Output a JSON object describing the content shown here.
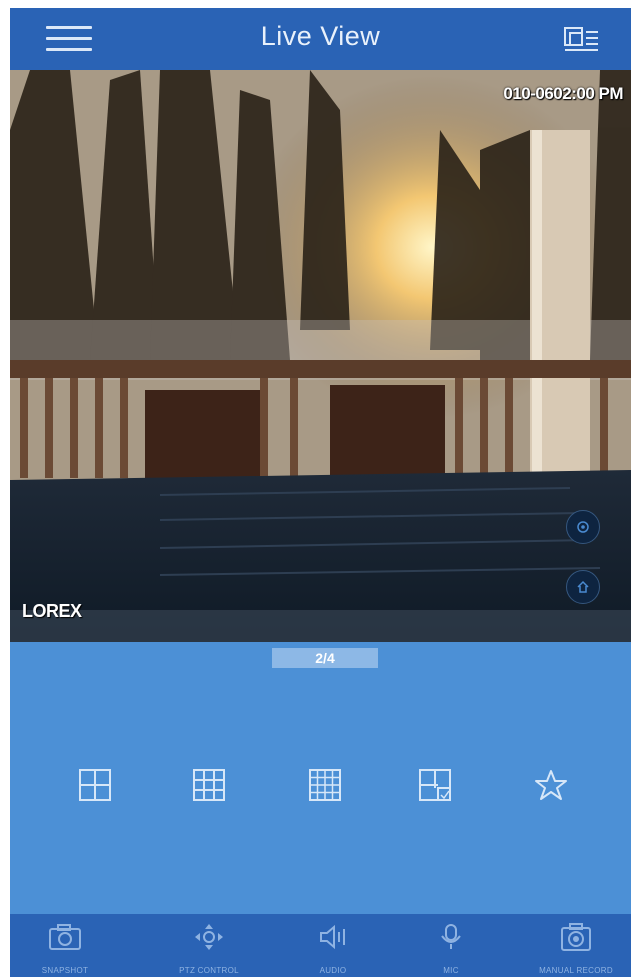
{
  "header": {
    "title": "Live View"
  },
  "video": {
    "timestamp": "010-0602:00 PM",
    "brand": "LOREX"
  },
  "pager": {
    "label": "2/4"
  },
  "layouts": [
    "single-view",
    "quad-view",
    "nine-view",
    "sixteen-view",
    "custom-view",
    "favorites"
  ],
  "toolbar": {
    "items": [
      {
        "label": "SNAPSHOT",
        "icon": "camera-icon"
      },
      {
        "label": "PTZ CONTROL",
        "icon": "ptz-icon"
      },
      {
        "label": "AUDIO",
        "icon": "speaker-icon"
      },
      {
        "label": "MIC",
        "icon": "mic-icon"
      },
      {
        "label": "MANUAL RECORD",
        "icon": "record-icon"
      }
    ]
  },
  "colors": {
    "header": "#2a63b5",
    "body": "#4c90d6",
    "pager": "#8db8e6"
  }
}
